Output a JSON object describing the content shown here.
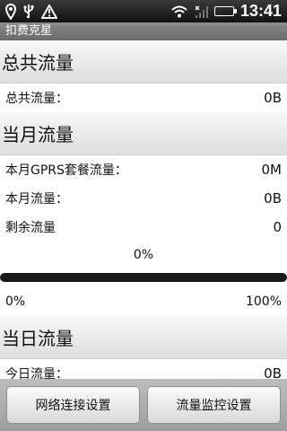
{
  "status_bar": {
    "time": "13:41",
    "battery_level": 0.9,
    "icons": [
      "location-pin-icon",
      "usb-icon",
      "warning-icon",
      "wifi-icon",
      "signal-icon",
      "battery-icon"
    ]
  },
  "app": {
    "title": "扣费克星"
  },
  "total": {
    "header": "总共流量",
    "label": "总共流量：",
    "value": "0B"
  },
  "month": {
    "header": "当月流量",
    "package_label": "本月GPRS套餐流量：",
    "package_value": "0M",
    "used_label": "本月流量：",
    "used_value": "0B",
    "remaining_label": "剩余流量",
    "remaining_value": "0",
    "progress_text": "0%",
    "progress_value": 0,
    "progress_min_label": "0%",
    "progress_max_label": "100%"
  },
  "today": {
    "header": "当日流量",
    "label": "今日流量：",
    "value": "0B"
  },
  "buttons": {
    "network_settings": "网络连接设置",
    "monitor_settings": "流量监控设置"
  },
  "colors": {
    "progress_fill": "#2a7bdc",
    "battery_fill": "#4bd64b"
  }
}
